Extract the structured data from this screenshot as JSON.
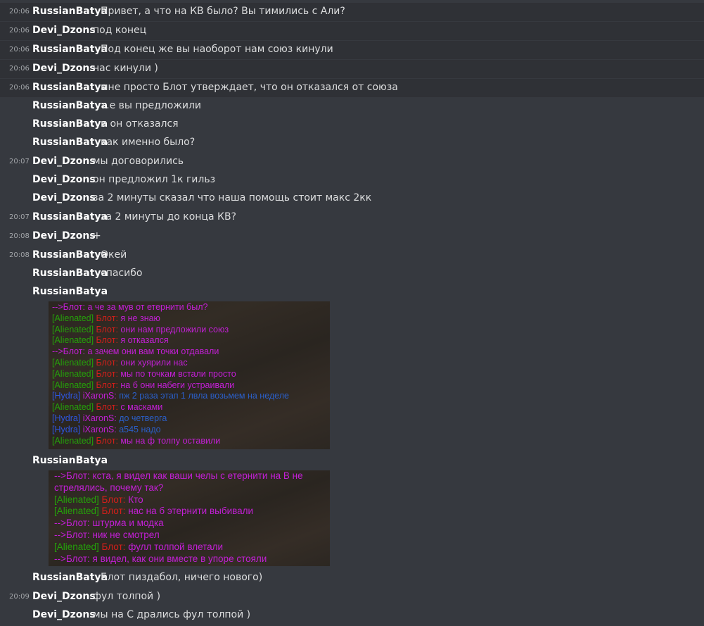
{
  "messages": [
    {
      "time": "20:06",
      "author": "RussianBatya",
      "text": "Привет, а что на КВ было? Вы тимились с Али?"
    },
    {
      "time": "20:06",
      "author": "Devi_Dzons",
      "text": "под конец"
    },
    {
      "time": "20:06",
      "author": "RussianBatya",
      "text": "Под конец же вы наоборот нам союз кинули"
    },
    {
      "time": "20:06",
      "author": "Devi_Dzons",
      "text": "нас кинули )"
    },
    {
      "time": "20:06",
      "author": "RussianBatya",
      "text": "мне просто Блот утверждает, что он отказался от союза"
    },
    {
      "time": "",
      "author": "RussianBatya",
      "text": "т.е вы предложили"
    },
    {
      "time": "",
      "author": "RussianBatya",
      "text": "и он отказался"
    },
    {
      "time": "",
      "author": "RussianBatya",
      "text": "как именно было?"
    },
    {
      "time": "20:07",
      "author": "Devi_Dzons",
      "text": "мы договорились"
    },
    {
      "time": "",
      "author": "Devi_Dzons",
      "text": "он предложил 1к гильз"
    },
    {
      "time": "",
      "author": "Devi_Dzons",
      "text": "за 2 минуты сказал что наша помощь стоит макс 2кк"
    },
    {
      "time": "20:07",
      "author": "RussianBatya",
      "text": "за 2 минуты до конца КВ?"
    },
    {
      "time": "20:08",
      "author": "Devi_Dzons",
      "text": "+"
    },
    {
      "time": "20:08",
      "author": "RussianBatya",
      "text": "Окей"
    },
    {
      "time": "",
      "author": "RussianBatya",
      "text": "спасибо"
    },
    {
      "time": "",
      "author": "RussianBatya",
      "text": ""
    },
    {
      "time": "",
      "author": "RussianBatya",
      "text": ""
    },
    {
      "time": "",
      "author": "RussianBatya",
      "text": "Блот пиздабол, ничего нового)"
    },
    {
      "time": "20:09",
      "author": "Devi_Dzons",
      "text": "фул толпой )"
    },
    {
      "time": "",
      "author": "Devi_Dzons",
      "text": "мы на С дрались фул толпой )"
    }
  ],
  "screenshot_1": [
    [
      {
        "c": "pm",
        "t": "-->Блот: а че за мув от етернити был?"
      }
    ],
    [
      {
        "c": "tag",
        "t": "[Alienated] "
      },
      {
        "c": "red",
        "t": "Блот: "
      },
      {
        "c": "pm",
        "t": "я не знаю"
      }
    ],
    [
      {
        "c": "tag",
        "t": "[Alienated] "
      },
      {
        "c": "red",
        "t": "Блот: "
      },
      {
        "c": "pm",
        "t": "они нам предложили союз"
      }
    ],
    [
      {
        "c": "tag",
        "t": "[Alienated] "
      },
      {
        "c": "red",
        "t": "Блот: "
      },
      {
        "c": "pm",
        "t": "я отказался"
      }
    ],
    [
      {
        "c": "pm",
        "t": "-->Блот: а зачем они вам точки отдавали"
      }
    ],
    [
      {
        "c": "tag",
        "t": "[Alienated] "
      },
      {
        "c": "red",
        "t": "Блот: "
      },
      {
        "c": "pm",
        "t": "они хуярили нас"
      }
    ],
    [
      {
        "c": "tag",
        "t": "[Alienated] "
      },
      {
        "c": "red",
        "t": "Блот: "
      },
      {
        "c": "pm",
        "t": "мы по точкам встали просто"
      }
    ],
    [
      {
        "c": "tag",
        "t": "[Alienated] "
      },
      {
        "c": "red",
        "t": "Блот: "
      },
      {
        "c": "pm",
        "t": "на б они набеги устраивали"
      }
    ],
    [
      {
        "c": "blue",
        "t": "[Hydra] "
      },
      {
        "c": "pm",
        "t": "iXaronS: "
      },
      {
        "c": "bluet",
        "t": "пж 2 раза этап 1 лвла возьмем на неделе"
      }
    ],
    [
      {
        "c": "tag",
        "t": "[Alienated] "
      },
      {
        "c": "red",
        "t": "Блот: "
      },
      {
        "c": "pm",
        "t": "с масками"
      }
    ],
    [
      {
        "c": "blue",
        "t": "[Hydra] "
      },
      {
        "c": "pm",
        "t": "iXaronS: "
      },
      {
        "c": "bluet",
        "t": "до четверга"
      }
    ],
    [
      {
        "c": "blue",
        "t": "[Hydra] "
      },
      {
        "c": "pm",
        "t": "iXaronS: "
      },
      {
        "c": "bluet",
        "t": "a545 надо"
      }
    ],
    [
      {
        "c": "tag",
        "t": "[Alienated] "
      },
      {
        "c": "red",
        "t": "Блот: "
      },
      {
        "c": "pm",
        "t": "мы на ф толпу оставили"
      }
    ]
  ],
  "screenshot_2": [
    [
      {
        "c": "pm",
        "t": "-->Блот: кста, я видел как ваши челы с етернити на В не"
      }
    ],
    [
      {
        "c": "pm",
        "t": "стрелялись, почему так?"
      }
    ],
    [
      {
        "c": "tag",
        "t": "[Alienated] "
      },
      {
        "c": "red",
        "t": "Блот: "
      },
      {
        "c": "pm",
        "t": "Кто"
      }
    ],
    [
      {
        "c": "tag",
        "t": "[Alienated] "
      },
      {
        "c": "red",
        "t": "Блот: "
      },
      {
        "c": "pm",
        "t": "нас на б этернити выбивали"
      }
    ],
    [
      {
        "c": "pm",
        "t": "-->Блот: штурма и модка"
      }
    ],
    [
      {
        "c": "pm",
        "t": "-->Блот: ник не смотрел"
      }
    ],
    [
      {
        "c": "tag",
        "t": "[Alienated] "
      },
      {
        "c": "red",
        "t": "Блот: "
      },
      {
        "c": "pm",
        "t": "фулл толпой влетали"
      }
    ],
    [
      {
        "c": "pm",
        "t": "-->Блот: я видел, как они вместе в упоре стояли"
      }
    ]
  ]
}
